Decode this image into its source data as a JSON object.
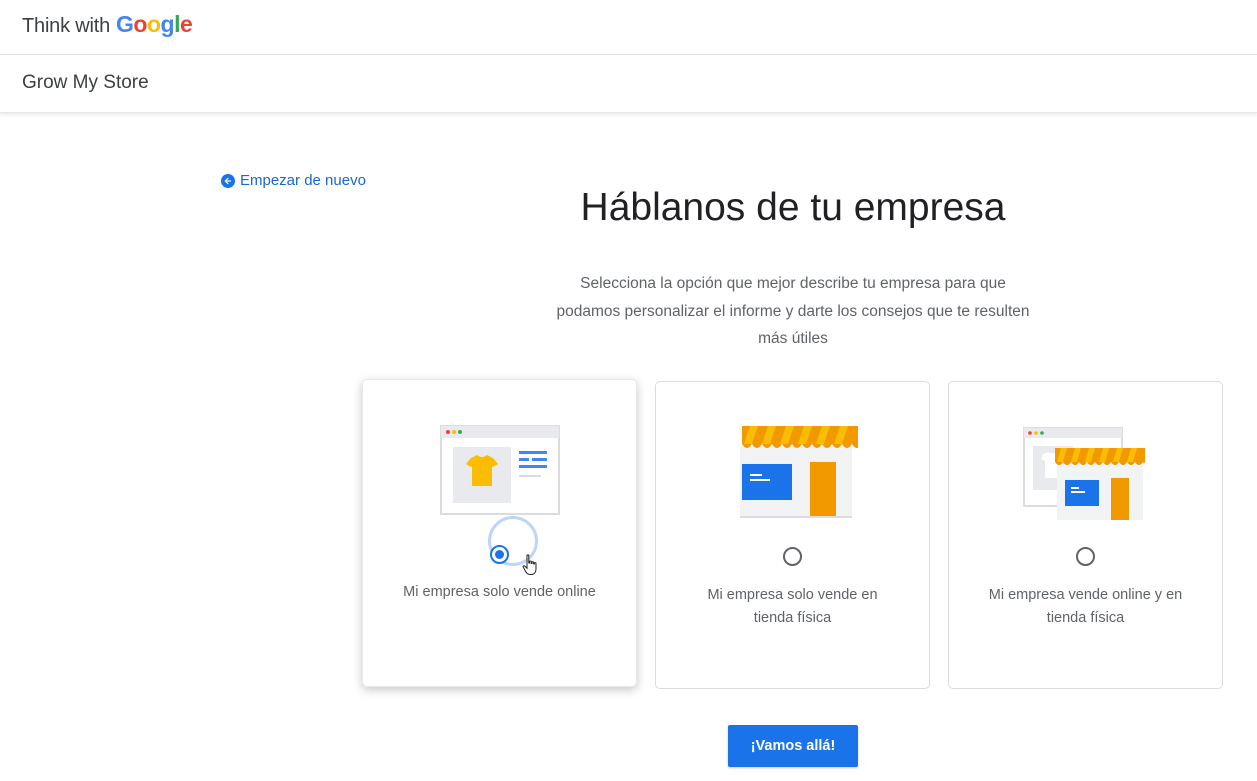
{
  "header": {
    "brand_prefix": "Think with",
    "brand_google": [
      "G",
      "o",
      "o",
      "g",
      "l",
      "e"
    ]
  },
  "subheader": {
    "title": "Grow My Store"
  },
  "nav": {
    "restart_label": "Empezar de nuevo",
    "restart_icon": "arrow-back-circle-icon"
  },
  "main": {
    "heading": "Háblanos de tu empresa",
    "description": "Selecciona la opción que mejor describe tu empresa para que podamos personalizar el informe y darte los consejos que te resulten más útiles",
    "options": [
      {
        "label": "Mi empresa solo vende online",
        "selected": true,
        "icon": "online-store-illustration"
      },
      {
        "label": "Mi empresa solo vende en tienda física",
        "selected": false,
        "icon": "physical-store-illustration"
      },
      {
        "label": "Mi empresa vende online y en tienda física",
        "selected": false,
        "icon": "online-and-physical-store-illustration"
      }
    ],
    "submit_label": "¡Vamos allá!"
  },
  "colors": {
    "accent": "#1a73e8",
    "awning_orange": "#f29900",
    "awning_yellow": "#fbbc04",
    "shirt": "#fbbc04"
  }
}
